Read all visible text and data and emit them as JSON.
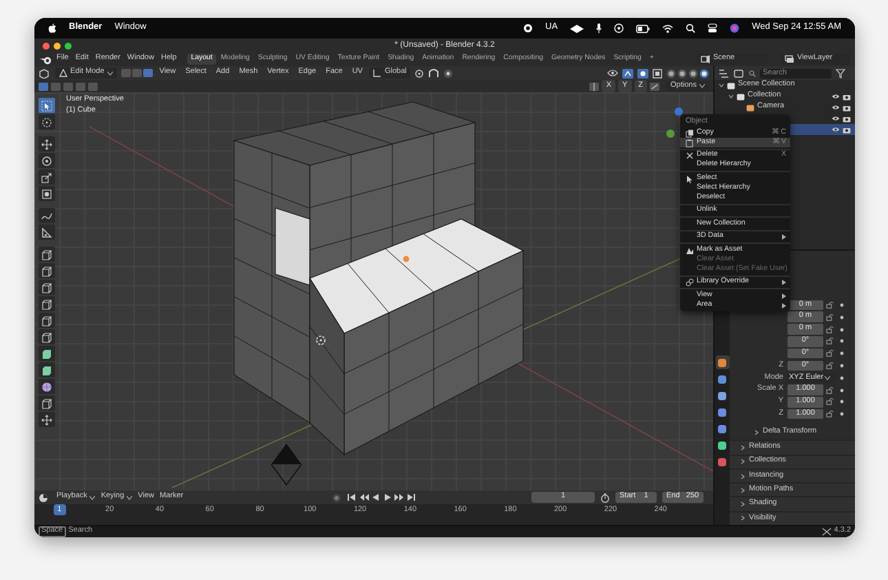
{
  "menubar": {
    "app": "Blender",
    "menus": [
      "Window"
    ],
    "status_text": "UA",
    "clock": "Wed Sep 24  12:55 AM"
  },
  "window": {
    "title": "* (Unsaved) - Blender 4.3.2"
  },
  "menu": [
    "File",
    "Edit",
    "Render",
    "Window",
    "Help"
  ],
  "workspaces": [
    {
      "label": "Layout",
      "selected": true
    },
    {
      "label": "Modeling",
      "selected": false
    },
    {
      "label": "Sculpting",
      "selected": false
    },
    {
      "label": "UV Editing",
      "selected": false
    },
    {
      "label": "Texture Paint",
      "selected": false
    },
    {
      "label": "Shading",
      "selected": false
    },
    {
      "label": "Animation",
      "selected": false
    },
    {
      "label": "Rendering",
      "selected": false
    },
    {
      "label": "Compositing",
      "selected": false
    },
    {
      "label": "Geometry Nodes",
      "selected": false
    },
    {
      "label": "Scripting",
      "selected": false
    }
  ],
  "add_workspace": "+",
  "scene": "Scene",
  "view_layer": "ViewLayer",
  "viewport_header": {
    "mode": "Edit Mode",
    "select_modes": [
      {
        "selected": false
      },
      {
        "selected": false
      },
      {
        "selected": true
      }
    ],
    "menus": [
      "View",
      "Select",
      "Add",
      "Mesh",
      "Vertex",
      "Edge",
      "Face",
      "UV"
    ],
    "orientation": "Global",
    "shading": [
      {
        "selected": false
      },
      {
        "selected": false
      },
      {
        "selected": false
      },
      {
        "selected": true
      }
    ]
  },
  "tool_settings": {
    "select_box": [
      {
        "selected": true
      },
      {
        "selected": false
      },
      {
        "selected": false
      },
      {
        "selected": false
      },
      {
        "selected": false
      }
    ],
    "axes": [
      "X",
      "Y",
      "Z"
    ],
    "options": "Options"
  },
  "viewport": {
    "view_name": "User Perspective",
    "object_name": "(1) Cube"
  },
  "tools": [
    {
      "kind": "select",
      "selected": true
    },
    {
      "kind": "cursor",
      "selected": false
    },
    {
      "kind": "separator"
    },
    {
      "kind": "move",
      "selected": false
    },
    {
      "kind": "rotate",
      "selected": false
    },
    {
      "kind": "scale",
      "selected": false
    },
    {
      "kind": "transform",
      "selected": false
    },
    {
      "kind": "separator"
    },
    {
      "kind": "annotate",
      "selected": false
    },
    {
      "kind": "measure",
      "selected": false
    },
    {
      "kind": "separator"
    },
    {
      "kind": "cube",
      "selected": false
    },
    {
      "kind": "cube",
      "selected": false
    },
    {
      "kind": "cube",
      "selected": false
    },
    {
      "kind": "cube",
      "selected": false
    },
    {
      "kind": "cube",
      "selected": false
    },
    {
      "kind": "cube",
      "selected": false
    },
    {
      "kind": "solid",
      "selected": false
    },
    {
      "kind": "solid",
      "selected": false
    },
    {
      "kind": "sphere",
      "selected": false
    },
    {
      "kind": "cube",
      "selected": false
    },
    {
      "kind": "move",
      "selected": false
    }
  ],
  "outliner": {
    "search": {
      "placeholder": "Search"
    },
    "items": [
      {
        "name": "Scene Collection",
        "selected": false,
        "children": [
          {
            "name": "Collection",
            "selected": false,
            "children": [
              {
                "name": "Camera",
                "selected": false
              },
              {
                "selected": false
              },
              {
                "selected": true
              }
            ]
          }
        ]
      }
    ]
  },
  "context_menu": {
    "title": "Object",
    "items": [
      {
        "kind": "item",
        "label": "Copy",
        "shortcut": "⌘ C",
        "selected": false,
        "disabled": false,
        "submenu": false
      },
      {
        "kind": "item",
        "label": "Paste",
        "shortcut": "⌘ V",
        "selected": true,
        "disabled": false,
        "submenu": false
      },
      {
        "kind": "separator"
      },
      {
        "kind": "item",
        "label": "Delete",
        "shortcut": "X",
        "selected": false,
        "disabled": false,
        "submenu": false
      },
      {
        "kind": "item",
        "label": "Delete Hierarchy",
        "selected": false,
        "disabled": false,
        "submenu": false
      },
      {
        "kind": "separator"
      },
      {
        "kind": "item",
        "label": "Select",
        "selected": false,
        "disabled": false,
        "submenu": false
      },
      {
        "kind": "item",
        "label": "Select Hierarchy",
        "selected": false,
        "disabled": false,
        "submenu": false
      },
      {
        "kind": "item",
        "label": "Deselect",
        "selected": false,
        "disabled": false,
        "submenu": false
      },
      {
        "kind": "separator"
      },
      {
        "kind": "item",
        "label": "Unlink",
        "selected": false,
        "disabled": false,
        "submenu": false
      },
      {
        "kind": "separator"
      },
      {
        "kind": "item",
        "label": "New Collection",
        "selected": false,
        "disabled": false,
        "submenu": false
      },
      {
        "kind": "separator"
      },
      {
        "kind": "item",
        "label": "3D Data",
        "selected": false,
        "disabled": false,
        "submenu": true
      },
      {
        "kind": "separator"
      },
      {
        "kind": "item",
        "label": "Mark as Asset",
        "selected": false,
        "disabled": false,
        "submenu": false
      },
      {
        "kind": "item",
        "label": "Clear Asset",
        "selected": false,
        "disabled": true,
        "submenu": false
      },
      {
        "kind": "item",
        "label": "Clear Asset (Set Fake User)",
        "selected": false,
        "disabled": true,
        "submenu": false
      },
      {
        "kind": "separator"
      },
      {
        "kind": "item",
        "label": "Library Override",
        "selected": false,
        "disabled": false,
        "submenu": true
      },
      {
        "kind": "separator"
      },
      {
        "kind": "item",
        "label": "View",
        "selected": false,
        "disabled": false,
        "submenu": true
      },
      {
        "kind": "item",
        "label": "Area",
        "selected": false,
        "disabled": false,
        "submenu": true
      }
    ]
  },
  "properties": {
    "tabs": [
      {
        "color": "#e0893a",
        "selected": true
      },
      {
        "color": "#5c8fd6",
        "selected": false
      },
      {
        "color": "#7aa0e0",
        "selected": false
      },
      {
        "color": "#6a8ce0",
        "selected": false
      },
      {
        "color": "#6a8ce0",
        "selected": false
      },
      {
        "color": "#4fcf8f",
        "selected": false
      },
      {
        "color": "#d9535f",
        "selected": false
      }
    ],
    "rows": [
      {
        "kind": "field",
        "value": "0 m"
      },
      {
        "kind": "field",
        "value": "0 m"
      },
      {
        "kind": "field",
        "value": "0 m"
      },
      {
        "kind": "field",
        "value": "0°"
      },
      {
        "kind": "field",
        "value": "0°"
      },
      {
        "kind": "field",
        "label": "Z",
        "value": "0°"
      },
      {
        "kind": "dropdown",
        "label": "Mode",
        "value": "XYZ Euler"
      },
      {
        "kind": "field",
        "label": "Scale X",
        "value": "1.000"
      },
      {
        "kind": "field",
        "label": "Y",
        "value": "1.000"
      },
      {
        "kind": "field",
        "label": "Z",
        "value": "1.000"
      }
    ],
    "panels": [
      {
        "kind": "subpanel",
        "label": "Delta Transform"
      },
      {
        "kind": "panel",
        "label": "Relations"
      },
      {
        "kind": "panel",
        "label": "Collections"
      },
      {
        "kind": "panel",
        "label": "Instancing"
      },
      {
        "kind": "panel",
        "label": "Motion Paths"
      },
      {
        "kind": "panel",
        "label": "Shading"
      },
      {
        "kind": "panel",
        "label": "Visibility"
      }
    ]
  },
  "timeline": {
    "menus": [
      {
        "label": "Playback",
        "dropdown": true
      },
      {
        "label": "Keying",
        "dropdown": true
      },
      {
        "label": "View",
        "dropdown": false
      },
      {
        "label": "Marker",
        "dropdown": false
      }
    ],
    "current_frame": "1",
    "start_label": "Start",
    "start": "1",
    "end_label": "End",
    "end": "250",
    "ruler": [
      {
        "label": "1",
        "selected": true
      },
      {
        "label": "20",
        "selected": false
      },
      {
        "label": "40",
        "selected": false
      },
      {
        "label": "60",
        "selected": false
      },
      {
        "label": "80",
        "selected": false
      },
      {
        "label": "100",
        "selected": false
      },
      {
        "label": "120",
        "selected": false
      },
      {
        "label": "140",
        "selected": false
      },
      {
        "label": "160",
        "selected": false
      },
      {
        "label": "180",
        "selected": false
      },
      {
        "label": "200",
        "selected": false
      },
      {
        "label": "220",
        "selected": false
      },
      {
        "label": "240",
        "selected": false
      }
    ]
  },
  "status_bar": {
    "key": "Space",
    "action": "Search",
    "version": "4.3.2"
  }
}
